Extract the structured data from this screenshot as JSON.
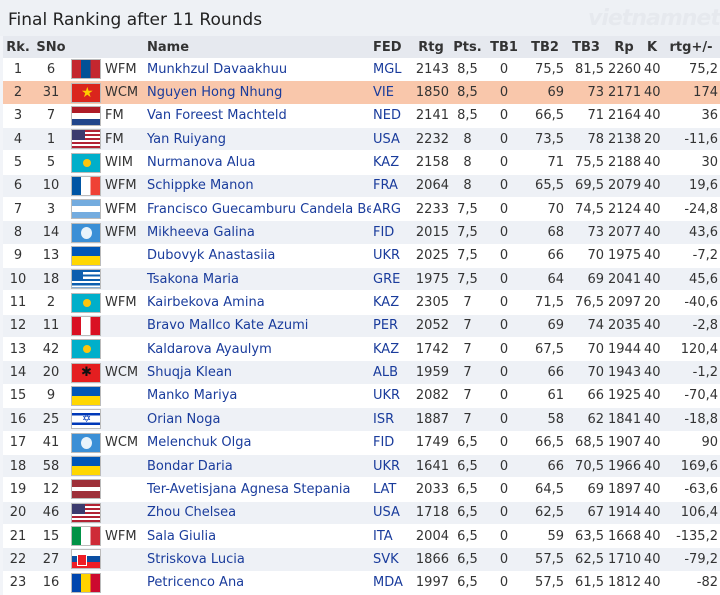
{
  "title": "Final Ranking after 11 Rounds",
  "headers": {
    "rk": "Rk.",
    "sno": "SNo",
    "name": "Name",
    "fed": "FED",
    "rtg": "Rtg",
    "pts": "Pts.",
    "tb1": "TB1",
    "tb2": "TB2",
    "tb3": "TB3",
    "rp": "Rp",
    "k": "K",
    "rtg_change": "rtg+/-"
  },
  "highlight_rank": "2",
  "rows": [
    {
      "rk": "1",
      "sno": "6",
      "flag": "MGL",
      "title": "WFM",
      "name": "Munkhzul Davaakhuu",
      "fed": "MGL",
      "rtg": "2143",
      "pts": "8,5",
      "tb1": "0",
      "tb2": "75,5",
      "tb3": "81,5",
      "rp": "2260",
      "k": "40",
      "chg": "75,2"
    },
    {
      "rk": "2",
      "sno": "31",
      "flag": "VIE",
      "title": "WCM",
      "name": "Nguyen Hong Nhung",
      "fed": "VIE",
      "rtg": "1850",
      "pts": "8,5",
      "tb1": "0",
      "tb2": "69",
      "tb3": "73",
      "rp": "2171",
      "k": "40",
      "chg": "174"
    },
    {
      "rk": "3",
      "sno": "7",
      "flag": "NED",
      "title": "FM",
      "name": "Van Foreest Machteld",
      "fed": "NED",
      "rtg": "2141",
      "pts": "8,5",
      "tb1": "0",
      "tb2": "66,5",
      "tb3": "71",
      "rp": "2164",
      "k": "40",
      "chg": "36"
    },
    {
      "rk": "4",
      "sno": "1",
      "flag": "USA",
      "title": "FM",
      "name": "Yan Ruiyang",
      "fed": "USA",
      "rtg": "2232",
      "pts": "8",
      "tb1": "0",
      "tb2": "73,5",
      "tb3": "78",
      "rp": "2138",
      "k": "20",
      "chg": "-11,6"
    },
    {
      "rk": "5",
      "sno": "5",
      "flag": "KAZ",
      "title": "WIM",
      "name": "Nurmanova Alua",
      "fed": "KAZ",
      "rtg": "2158",
      "pts": "8",
      "tb1": "0",
      "tb2": "71",
      "tb3": "75,5",
      "rp": "2188",
      "k": "40",
      "chg": "30"
    },
    {
      "rk": "6",
      "sno": "10",
      "flag": "FRA",
      "title": "WFM",
      "name": "Schippke Manon",
      "fed": "FRA",
      "rtg": "2064",
      "pts": "8",
      "tb1": "0",
      "tb2": "65,5",
      "tb3": "69,5",
      "rp": "2079",
      "k": "40",
      "chg": "19,6"
    },
    {
      "rk": "7",
      "sno": "3",
      "flag": "ARG",
      "title": "WFM",
      "name": "Francisco Guecamburu Candela Be",
      "fed": "ARG",
      "rtg": "2233",
      "pts": "7,5",
      "tb1": "0",
      "tb2": "70",
      "tb3": "74,5",
      "rp": "2124",
      "k": "40",
      "chg": "-24,8"
    },
    {
      "rk": "8",
      "sno": "14",
      "flag": "FID",
      "title": "WFM",
      "name": "Mikheeva Galina",
      "fed": "FID",
      "rtg": "2015",
      "pts": "7,5",
      "tb1": "0",
      "tb2": "68",
      "tb3": "73",
      "rp": "2077",
      "k": "40",
      "chg": "43,6"
    },
    {
      "rk": "9",
      "sno": "13",
      "flag": "UKR",
      "title": "",
      "name": "Dubovyk Anastasiia",
      "fed": "UKR",
      "rtg": "2025",
      "pts": "7,5",
      "tb1": "0",
      "tb2": "66",
      "tb3": "70",
      "rp": "1975",
      "k": "40",
      "chg": "-7,2"
    },
    {
      "rk": "10",
      "sno": "18",
      "flag": "GRE",
      "title": "",
      "name": "Tsakona Maria",
      "fed": "GRE",
      "rtg": "1975",
      "pts": "7,5",
      "tb1": "0",
      "tb2": "64",
      "tb3": "69",
      "rp": "2041",
      "k": "40",
      "chg": "45,6"
    },
    {
      "rk": "11",
      "sno": "2",
      "flag": "KAZ",
      "title": "WFM",
      "name": "Kairbekova Amina",
      "fed": "KAZ",
      "rtg": "2305",
      "pts": "7",
      "tb1": "0",
      "tb2": "71,5",
      "tb3": "76,5",
      "rp": "2097",
      "k": "20",
      "chg": "-40,6"
    },
    {
      "rk": "12",
      "sno": "11",
      "flag": "PER",
      "title": "",
      "name": "Bravo Mallco Kate Azumi",
      "fed": "PER",
      "rtg": "2052",
      "pts": "7",
      "tb1": "0",
      "tb2": "69",
      "tb3": "74",
      "rp": "2035",
      "k": "40",
      "chg": "-2,8"
    },
    {
      "rk": "13",
      "sno": "42",
      "flag": "KAZ",
      "title": "",
      "name": "Kaldarova Ayaulym",
      "fed": "KAZ",
      "rtg": "1742",
      "pts": "7",
      "tb1": "0",
      "tb2": "67,5",
      "tb3": "70",
      "rp": "1944",
      "k": "40",
      "chg": "120,4"
    },
    {
      "rk": "14",
      "sno": "20",
      "flag": "ALB",
      "title": "WCM",
      "name": "Shuqja Klean",
      "fed": "ALB",
      "rtg": "1959",
      "pts": "7",
      "tb1": "0",
      "tb2": "66",
      "tb3": "70",
      "rp": "1943",
      "k": "40",
      "chg": "-1,2"
    },
    {
      "rk": "15",
      "sno": "9",
      "flag": "UKR",
      "title": "",
      "name": "Manko Mariya",
      "fed": "UKR",
      "rtg": "2082",
      "pts": "7",
      "tb1": "0",
      "tb2": "61",
      "tb3": "66",
      "rp": "1925",
      "k": "40",
      "chg": "-70,4"
    },
    {
      "rk": "16",
      "sno": "25",
      "flag": "ISR",
      "title": "",
      "name": "Orian Noga",
      "fed": "ISR",
      "rtg": "1887",
      "pts": "7",
      "tb1": "0",
      "tb2": "58",
      "tb3": "62",
      "rp": "1841",
      "k": "40",
      "chg": "-18,8"
    },
    {
      "rk": "17",
      "sno": "41",
      "flag": "FID",
      "title": "WCM",
      "name": "Melenchuk Olga",
      "fed": "FID",
      "rtg": "1749",
      "pts": "6,5",
      "tb1": "0",
      "tb2": "66,5",
      "tb3": "68,5",
      "rp": "1907",
      "k": "40",
      "chg": "90"
    },
    {
      "rk": "18",
      "sno": "58",
      "flag": "UKR",
      "title": "",
      "name": "Bondar Daria",
      "fed": "UKR",
      "rtg": "1641",
      "pts": "6,5",
      "tb1": "0",
      "tb2": "66",
      "tb3": "70,5",
      "rp": "1966",
      "k": "40",
      "chg": "169,6"
    },
    {
      "rk": "19",
      "sno": "12",
      "flag": "LAT",
      "title": "",
      "name": "Ter-Avetisjana Agnesa Stepania",
      "fed": "LAT",
      "rtg": "2033",
      "pts": "6,5",
      "tb1": "0",
      "tb2": "64,5",
      "tb3": "69",
      "rp": "1897",
      "k": "40",
      "chg": "-63,6"
    },
    {
      "rk": "20",
      "sno": "46",
      "flag": "USA",
      "title": "",
      "name": "Zhou Chelsea",
      "fed": "USA",
      "rtg": "1718",
      "pts": "6,5",
      "tb1": "0",
      "tb2": "62,5",
      "tb3": "67",
      "rp": "1914",
      "k": "40",
      "chg": "106,4"
    },
    {
      "rk": "21",
      "sno": "15",
      "flag": "ITA",
      "title": "WFM",
      "name": "Sala Giulia",
      "fed": "ITA",
      "rtg": "2004",
      "pts": "6,5",
      "tb1": "0",
      "tb2": "59",
      "tb3": "63,5",
      "rp": "1668",
      "k": "40",
      "chg": "-135,2"
    },
    {
      "rk": "22",
      "sno": "27",
      "flag": "SVK",
      "title": "",
      "name": "Striskova Lucia",
      "fed": "SVK",
      "rtg": "1866",
      "pts": "6,5",
      "tb1": "0",
      "tb2": "57,5",
      "tb3": "62,5",
      "rp": "1710",
      "k": "40",
      "chg": "-79,2"
    },
    {
      "rk": "23",
      "sno": "16",
      "flag": "MDA",
      "title": "",
      "name": "Petricenco Ana",
      "fed": "MDA",
      "rtg": "1997",
      "pts": "6,5",
      "tb1": "0",
      "tb2": "57,5",
      "tb3": "61,5",
      "rp": "1812",
      "k": "40",
      "chg": "-82"
    }
  ]
}
